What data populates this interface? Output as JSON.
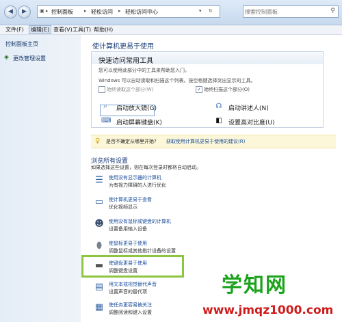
{
  "address": {
    "segments": [
      "控制面板",
      "轻松访问",
      "轻松访问中心"
    ]
  },
  "search": {
    "placeholder": "搜索控制面板"
  },
  "menu": [
    "文件(F)",
    "编辑(E)",
    "查看(V)",
    "工具(T)",
    "帮助(H)"
  ],
  "left_pane": {
    "home_link": "控制面板主页",
    "admin_link": "更改管理设置"
  },
  "main": {
    "heading": "使计算机更易于使用",
    "quick": {
      "title": "快速访问常用工具",
      "line1": "您可以使用此部分中的工具来帮助您入门。",
      "line2": "Windows 可以自动读取和扫描这个列表。按空格键选择突出显示的工具。",
      "always_read": "始终读取这个部分(W)",
      "always_scan": "始终扫描这个部分(O)",
      "magnifier": "启动放大镜(G)",
      "narrator": "启动讲述人(N)",
      "osk": "启动屏幕键盘(K)",
      "high_contrast": "设置高对比度(U)"
    },
    "tip": {
      "prefix": "是否不确定从哪里开始?",
      "link": "获取使用计算机更易于使用的建议(R)"
    },
    "browse": {
      "heading": "浏览所有设置",
      "desc": "如果选择这些设置，则在每次登录时都将自动启动。",
      "items": [
        {
          "title": "使用没有显示器的计算机",
          "sub": "为有视力障碍的人进行优化"
        },
        {
          "title": "使计算机更易于查看",
          "sub": "优化视频显示"
        },
        {
          "title": "使用没有鼠标或键盘的计算机",
          "sub": "设置备用输入设备"
        },
        {
          "title": "使鼠标更易于使用",
          "sub": "调整鼠标或其他指针设备的设置"
        },
        {
          "title": "使键盘更易于使用",
          "sub": "调整键盘设置"
        },
        {
          "title": "用文本或视觉替代声音",
          "sub": "设置声音的替代项"
        },
        {
          "title": "使任务更容易被关注",
          "sub": "调整阅读和键入设置"
        }
      ]
    }
  },
  "watermark": {
    "brand": "学知网",
    "url": "www.jmqz1000.com"
  },
  "colors": {
    "accent": "#1a4d9b",
    "highlight": "#8bc63e"
  }
}
